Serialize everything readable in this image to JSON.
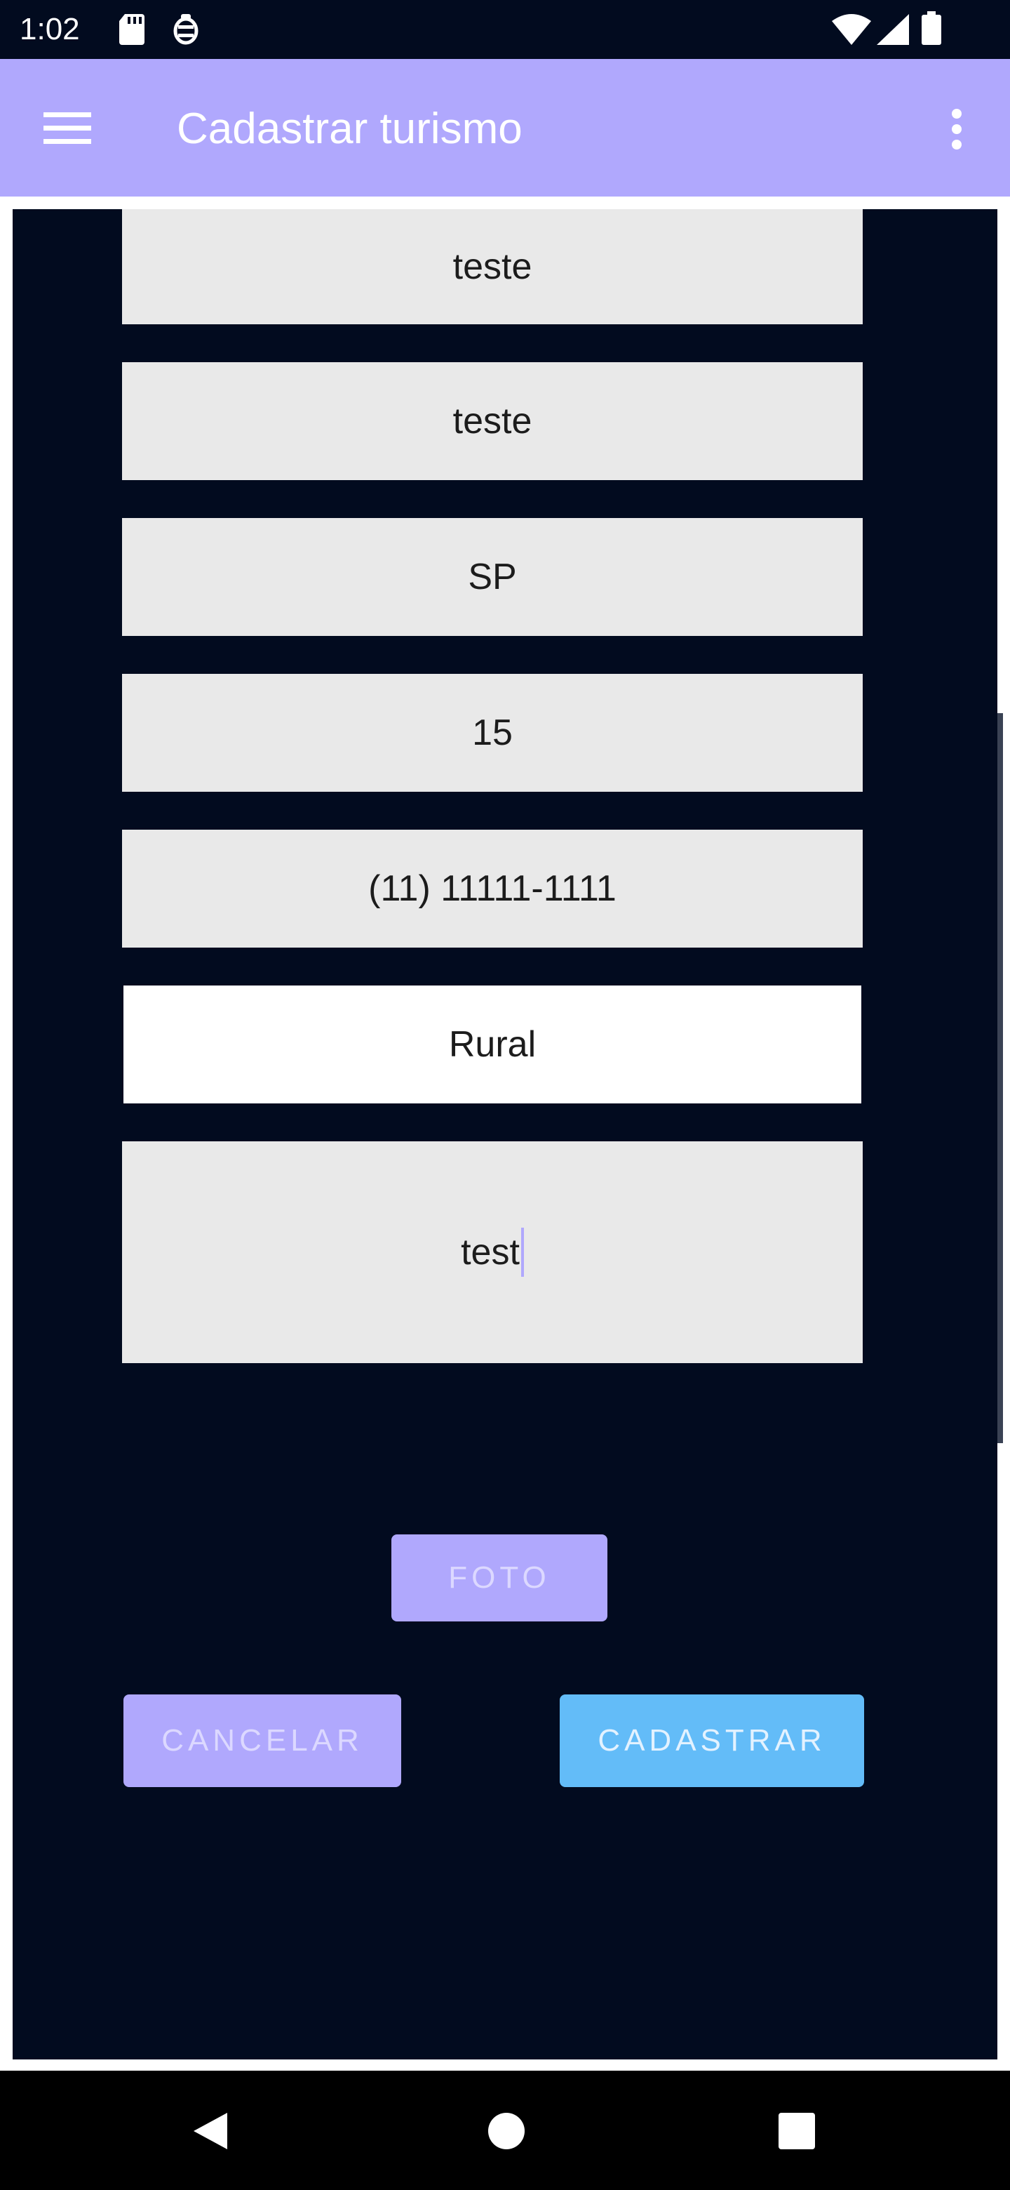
{
  "status_bar": {
    "time": "1:02",
    "left_icons": [
      "sd-card-icon",
      "debug-icon"
    ],
    "right_icons": [
      "wifi-icon",
      "cell-signal-icon",
      "battery-icon"
    ]
  },
  "app_bar": {
    "title": "Cadastrar turismo",
    "menu_icon": "menu-icon",
    "overflow_icon": "more-vert-icon",
    "color": "#b0a8fd"
  },
  "form": {
    "fields": [
      {
        "value": "teste"
      },
      {
        "value": "teste"
      },
      {
        "value": "SP"
      },
      {
        "value": "15"
      },
      {
        "value": "(11) 11111-1111"
      },
      {
        "value": "Rural"
      },
      {
        "value": "test"
      }
    ]
  },
  "buttons": {
    "photo": "FOTO",
    "cancel": "CANCELAR",
    "submit": "CADASTRAR"
  },
  "nav_bar": {
    "icons": [
      "back-icon",
      "home-icon",
      "recents-icon"
    ]
  },
  "colors": {
    "background": "#020b1f",
    "accent": "#b0a8fd",
    "submit": "#63bcf8"
  }
}
